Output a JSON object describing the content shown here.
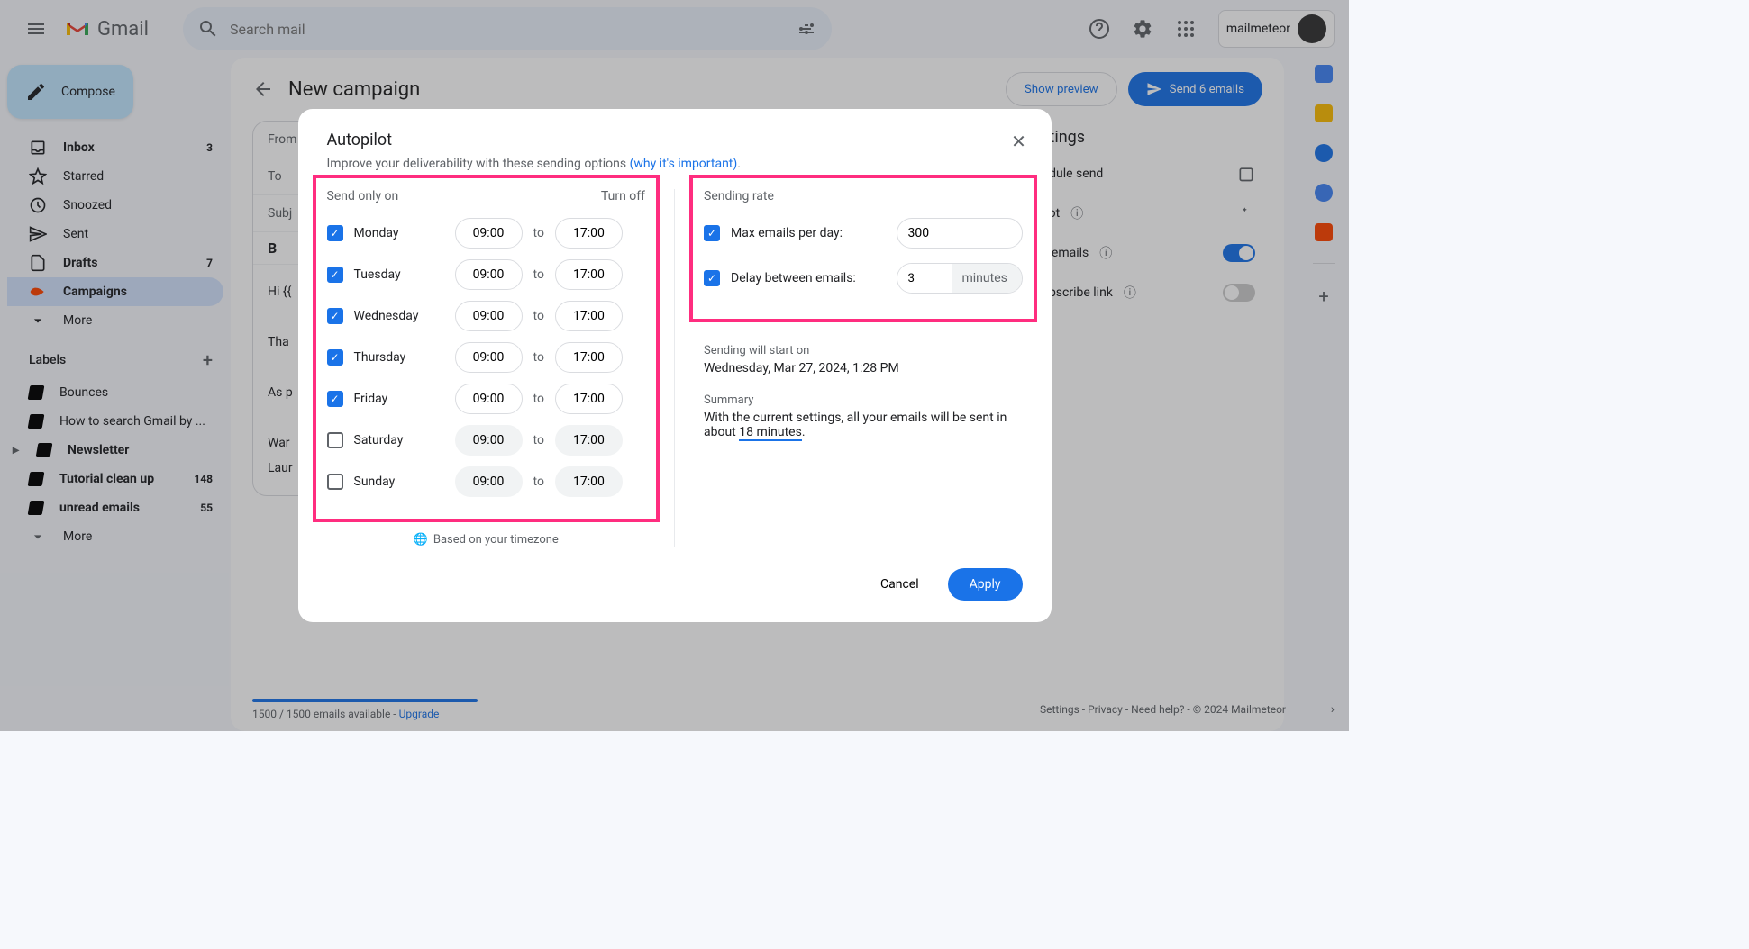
{
  "header": {
    "logo_text": "Gmail",
    "search_placeholder": "Search mail",
    "account_name": "mailmeteor"
  },
  "sidebar": {
    "compose": "Compose",
    "items": [
      {
        "icon": "inbox",
        "label": "Inbox",
        "count": "3",
        "bold": true
      },
      {
        "icon": "star",
        "label": "Starred"
      },
      {
        "icon": "clock",
        "label": "Snoozed"
      },
      {
        "icon": "send",
        "label": "Sent"
      },
      {
        "icon": "file",
        "label": "Drafts",
        "count": "7",
        "bold": true
      },
      {
        "icon": "campaign",
        "label": "Campaigns",
        "active": true,
        "bold": true
      },
      {
        "icon": "more",
        "label": "More"
      }
    ],
    "labels_header": "Labels",
    "labels": [
      {
        "label": "Bounces"
      },
      {
        "label": "How to search Gmail by ..."
      },
      {
        "label": "Newsletter",
        "bold": true,
        "expandable": true
      },
      {
        "label": "Tutorial clean up",
        "count": "148",
        "bold": true
      },
      {
        "label": "unread emails",
        "count": "55",
        "bold": true
      }
    ],
    "more": "More"
  },
  "campaign": {
    "title": "New campaign",
    "preview_btn": "Show preview",
    "send_btn": "Send 6 emails",
    "from_label": "From",
    "to_label": "To",
    "subj_label": "Subj",
    "bold_b": "B",
    "body_greeting": "Hi {{",
    "body_l2": "Tha",
    "body_l3": "As p",
    "body_l4": "War",
    "body_l5": "Laur"
  },
  "options": {
    "title": "ettings",
    "schedule": "hedule send",
    "autopilot": "pilot",
    "track": "ck emails",
    "unsubscribe": "subscribe link"
  },
  "footer": {
    "available": "1500 / 1500 emails available - ",
    "upgrade": "Upgrade",
    "right": "Settings - Privacy - Need help? - © 2024 Mailmeteor"
  },
  "modal": {
    "title": "Autopilot",
    "subtitle": "Improve your deliverability with these sending options ",
    "why_link": "(why it's important)",
    "send_only": "Send only on",
    "turn_off": "Turn off",
    "to": "to",
    "days": [
      {
        "name": "Monday",
        "checked": true,
        "start": "09:00",
        "end": "17:00"
      },
      {
        "name": "Tuesday",
        "checked": true,
        "start": "09:00",
        "end": "17:00"
      },
      {
        "name": "Wednesday",
        "checked": true,
        "start": "09:00",
        "end": "17:00"
      },
      {
        "name": "Thursday",
        "checked": true,
        "start": "09:00",
        "end": "17:00"
      },
      {
        "name": "Friday",
        "checked": true,
        "start": "09:00",
        "end": "17:00"
      },
      {
        "name": "Saturday",
        "checked": false,
        "start": "09:00",
        "end": "17:00"
      },
      {
        "name": "Sunday",
        "checked": false,
        "start": "09:00",
        "end": "17:00"
      }
    ],
    "timezone": "Based on your timezone",
    "sending_rate": "Sending rate",
    "max_label": "Max emails per day:",
    "max_value": "300",
    "delay_label": "Delay between emails:",
    "delay_value": "3",
    "delay_unit": "minutes",
    "start_label": "Sending will start on",
    "start_value": "Wednesday, Mar 27, 2024, 1:28 PM",
    "summary_label": "Summary",
    "summary_text1": "With the current settings, all your emails will be sent in about ",
    "summary_link": "18 minutes",
    "summary_text2": ".",
    "cancel": "Cancel",
    "apply": "Apply"
  }
}
